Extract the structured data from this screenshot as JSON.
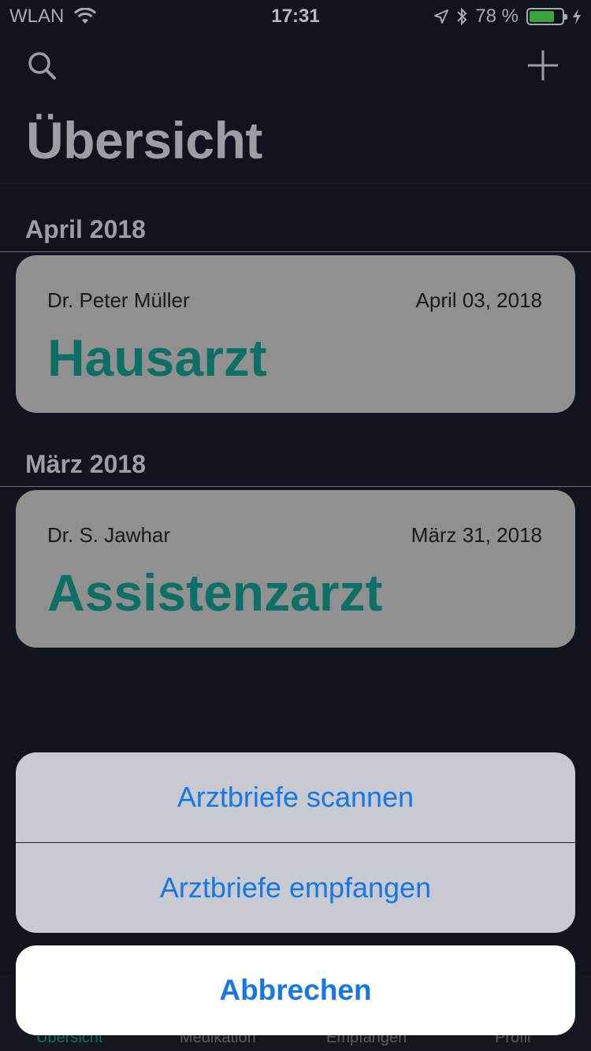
{
  "status_bar": {
    "carrier": "WLAN",
    "time": "17:31",
    "battery_percent": "78 %",
    "battery_level": 0.78,
    "battery_color": "#3aa53c"
  },
  "nav": {
    "search_icon": "search-icon",
    "add_icon": "plus-icon"
  },
  "page_title": "Übersicht",
  "sections": [
    {
      "header": "April 2018",
      "card": {
        "doctor": "Dr. Peter Müller",
        "date": "April 03, 2018",
        "type": "Hausarzt"
      }
    },
    {
      "header": "März 2018",
      "card": {
        "doctor": "Dr. S. Jawhar",
        "date": "März 31, 2018",
        "type": "Assistenzarzt"
      }
    }
  ],
  "action_sheet": {
    "options": [
      "Arztbriefe scannen",
      "Arztbriefe empfangen"
    ],
    "cancel": "Abbrechen"
  },
  "tab_bar": {
    "tabs": [
      "Übersicht",
      "Medikation",
      "Empfangen",
      "Profil"
    ],
    "active": "Übersicht"
  },
  "colors": {
    "accent": "#0e6f66",
    "action_blue": "#1478e6",
    "background": "#11131d"
  }
}
